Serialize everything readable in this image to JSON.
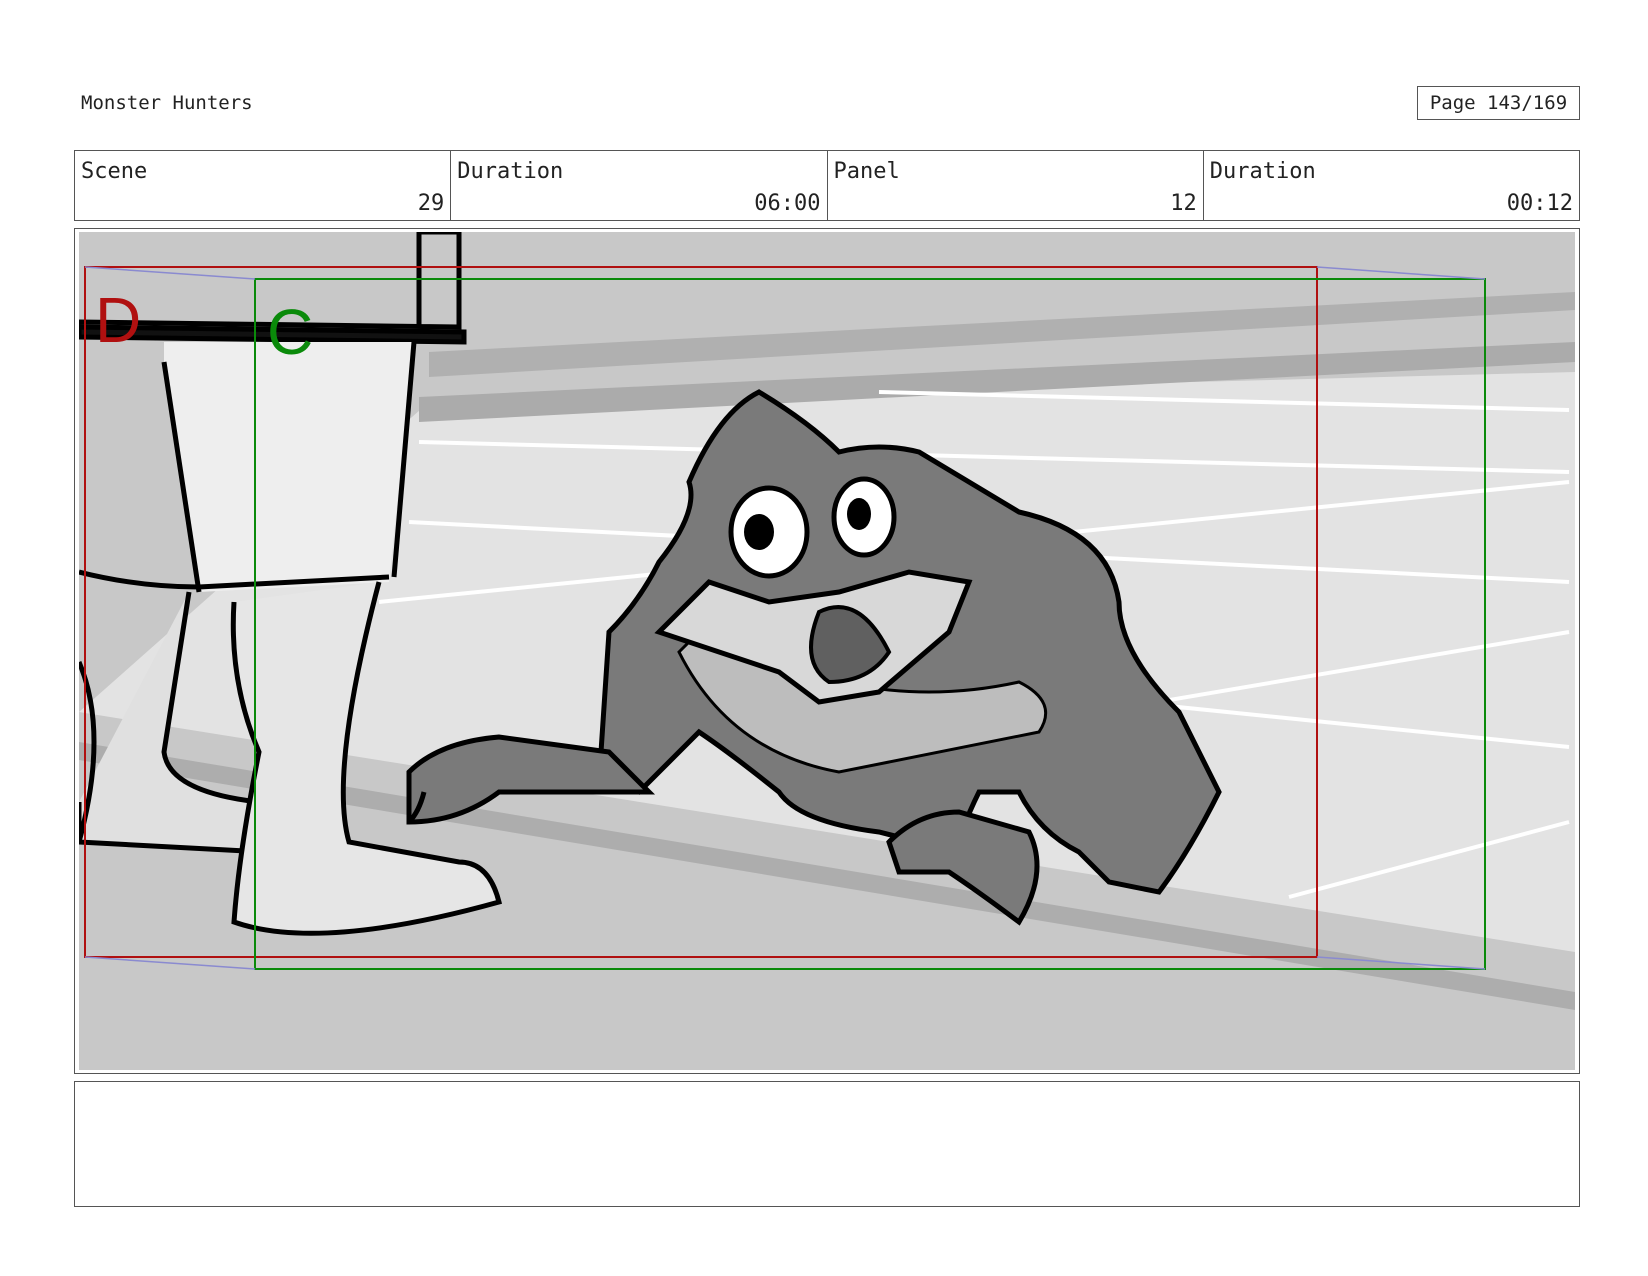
{
  "header": {
    "title": "Monster Hunters",
    "page_label": "Page 143/169"
  },
  "info": {
    "scene_label": "Scene",
    "scene_value": "29",
    "scene_duration_label": "Duration",
    "scene_duration_value": "06:00",
    "panel_label": "Panel",
    "panel_value": "12",
    "panel_duration_label": "Duration",
    "panel_duration_value": "00:12"
  },
  "panel": {
    "frame_d_label": "D",
    "frame_c_label": "C",
    "colors": {
      "frame_d": "#b01010",
      "frame_c": "#0a8a0a",
      "guide": "#8a8ad0",
      "background": "#c8c8c8",
      "monster": "#7a7a7a"
    }
  },
  "notes": {
    "text": ""
  }
}
